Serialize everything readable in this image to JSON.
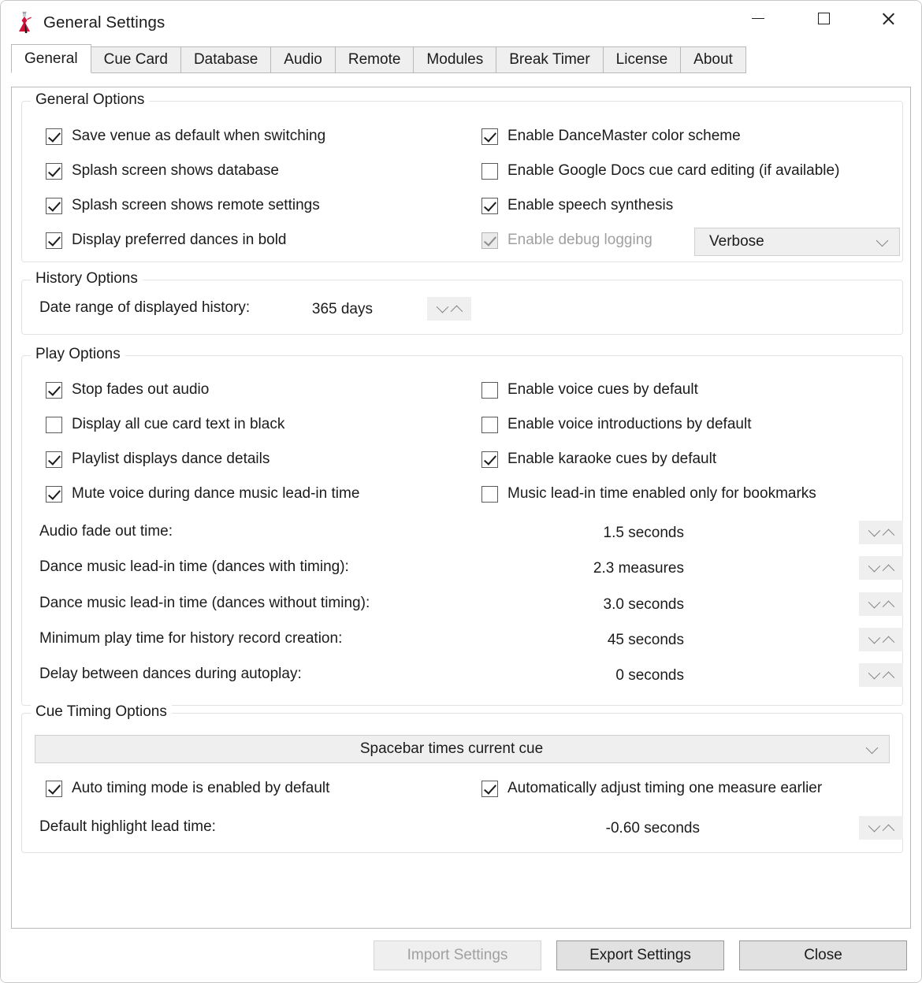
{
  "window": {
    "title": "General Settings",
    "icon": "dancer-icon",
    "controls": {
      "minimize": "minimize-icon",
      "maximize": "maximize-icon",
      "close": "close-icon"
    },
    "accent_color": "#d4113a"
  },
  "tabs": [
    {
      "label": "General",
      "selected": true
    },
    {
      "label": "Cue Card",
      "selected": false
    },
    {
      "label": "Database",
      "selected": false
    },
    {
      "label": "Audio",
      "selected": false
    },
    {
      "label": "Remote",
      "selected": false
    },
    {
      "label": "Modules",
      "selected": false
    },
    {
      "label": "Break Timer",
      "selected": false
    },
    {
      "label": "License",
      "selected": false
    },
    {
      "label": "About",
      "selected": false
    }
  ],
  "general_options": {
    "title": "General Options",
    "left": [
      {
        "label": "Save venue as default when switching",
        "checked": true
      },
      {
        "label": "Splash screen shows database",
        "checked": true
      },
      {
        "label": "Splash screen shows remote settings",
        "checked": true
      },
      {
        "label": "Display preferred dances in bold",
        "checked": true
      }
    ],
    "right": [
      {
        "label": "Enable DanceMaster color scheme",
        "checked": true,
        "disabled": false
      },
      {
        "label": "Enable Google Docs cue card editing (if available)",
        "checked": false,
        "disabled": false
      },
      {
        "label": "Enable speech synthesis",
        "checked": true,
        "disabled": false
      },
      {
        "label": "Enable debug logging",
        "checked": true,
        "disabled": true
      }
    ],
    "log_level": {
      "value": "Verbose"
    }
  },
  "history_options": {
    "title": "History Options",
    "date_range": {
      "label": "Date range of displayed history:",
      "value": "365 days"
    }
  },
  "play_options": {
    "title": "Play Options",
    "left": [
      {
        "label": "Stop fades out audio",
        "checked": true
      },
      {
        "label": "Display all cue card text in black",
        "checked": false
      },
      {
        "label": "Playlist displays dance details",
        "checked": true
      },
      {
        "label": "Mute voice during dance music lead-in time",
        "checked": true
      }
    ],
    "right": [
      {
        "label": "Enable voice cues by default",
        "checked": false
      },
      {
        "label": "Enable voice introductions by default",
        "checked": false
      },
      {
        "label": "Enable karaoke cues by default",
        "checked": true
      },
      {
        "label": "Music lead-in time enabled only for bookmarks",
        "checked": false
      }
    ],
    "values": [
      {
        "label": "Audio fade out time:",
        "value": "1.5 seconds"
      },
      {
        "label": "Dance music lead-in time (dances with timing):",
        "value": "2.3 measures"
      },
      {
        "label": "Dance music lead-in time (dances without timing):",
        "value": "3.0 seconds"
      },
      {
        "label": "Minimum play time for history record creation:",
        "value": "45 seconds"
      },
      {
        "label": "Delay between dances during autoplay:",
        "value": "0 seconds"
      }
    ]
  },
  "cue_timing_options": {
    "title": "Cue Timing Options",
    "mode": {
      "value": "Spacebar times current cue"
    },
    "checkboxes": [
      {
        "label": "Auto timing mode is enabled by default",
        "checked": true
      },
      {
        "label": "Automatically adjust timing one measure earlier",
        "checked": true
      }
    ],
    "lead_time": {
      "label": "Default highlight lead time:",
      "value": "-0.60 seconds"
    }
  },
  "footer": {
    "import_label": "Import Settings",
    "export_label": "Export Settings",
    "close_label": "Close"
  }
}
